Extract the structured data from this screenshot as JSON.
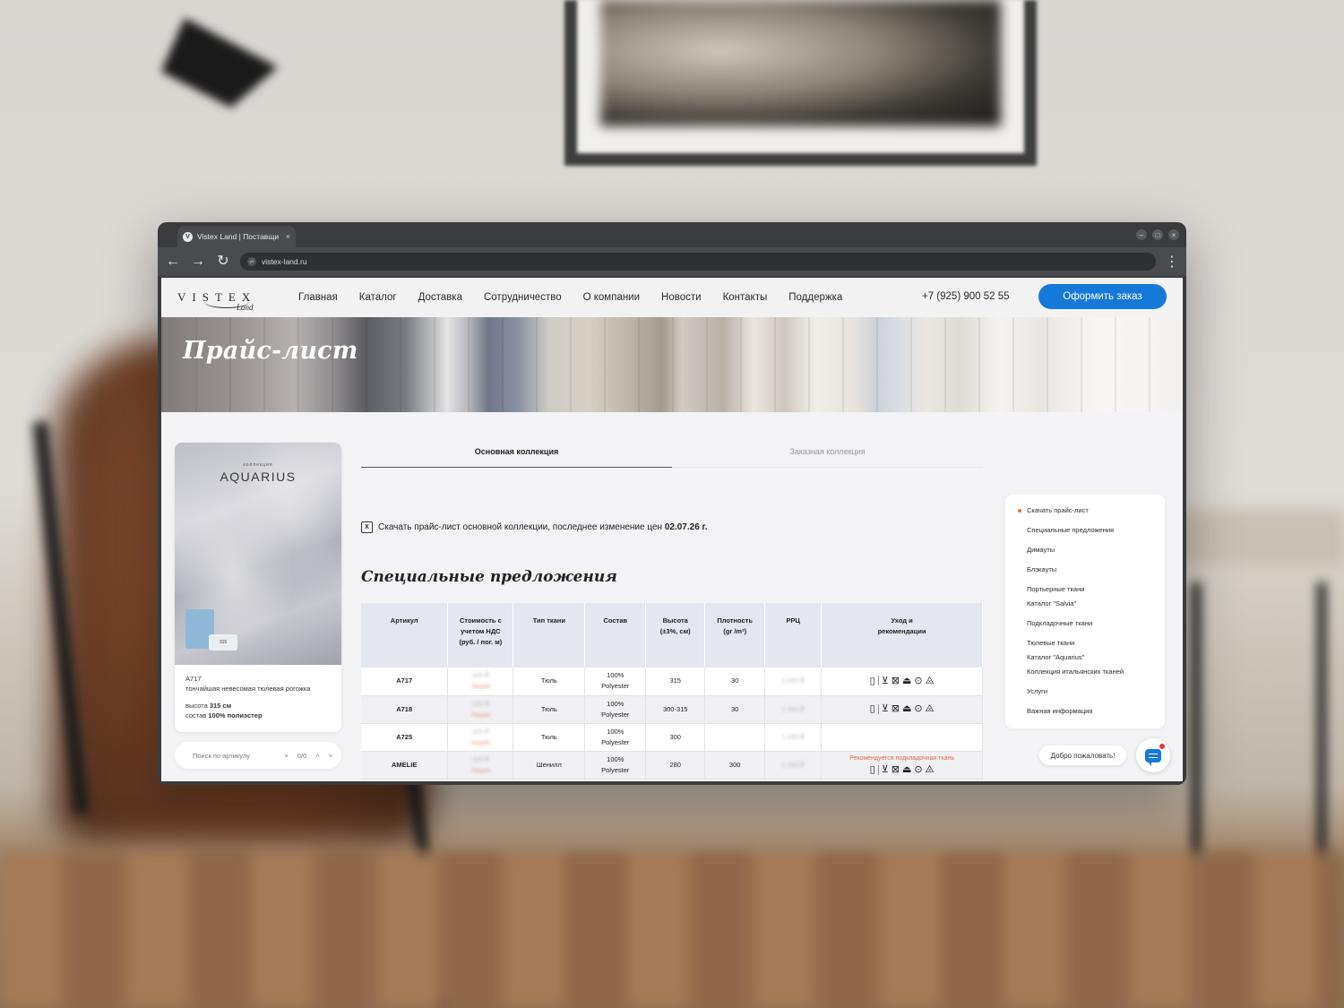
{
  "browser": {
    "tab_title": "Vistex Land | Поставщи",
    "tab_close": "×",
    "url": "vistex-land.ru",
    "menu": "⋮"
  },
  "site": {
    "logo_main": "VISTEX",
    "logo_sub": "Land",
    "nav": [
      "Главная",
      "Каталог",
      "Доставка",
      "Сотрудничество",
      "О компании",
      "Новости",
      "Контакты",
      "Поддержка"
    ],
    "phone": "+7 (925) 900 52 55",
    "order_button": "Оформить заказ"
  },
  "hero": {
    "title": "Прайс-лист"
  },
  "product_card": {
    "collection_small": "коллекция",
    "collection_name": "AQUARIUS",
    "box_label": "315",
    "article": "A717",
    "description": "тончайшая невесомая тюлевая рогожка",
    "height_label": "высота ",
    "height_value": "315 см",
    "composition_label": "состав ",
    "composition_value": "100% полиэстер"
  },
  "search": {
    "placeholder": "Поиск по артикулу",
    "clear": "×",
    "counter": "0/0",
    "up": "˄",
    "down": "˅"
  },
  "tabs": [
    "Основная коллекция",
    "Заказная коллекция"
  ],
  "download": {
    "text": "Скачать прайс-лист основной коллекции, последнее изменение цен ",
    "date": "02.07.26 г."
  },
  "section_title": "Специальные предложения",
  "table": {
    "headers": [
      "Артикул",
      "Стоимость с учетом НДС (руб. / пог. м)",
      "Тип ткани",
      "Состав",
      "Высота (±3%, см)",
      "Плотность (gr /m²)",
      "РРЦ",
      "Уход и рекомендации"
    ],
    "rows": [
      {
        "article": "A717",
        "price": "325 ₽",
        "price_note": "Акция",
        "type": "Тюль",
        "composition": "100% Polyester",
        "height": "315",
        "density": "30",
        "rrp": "1 050 ₽",
        "note": ""
      },
      {
        "article": "A718",
        "price": "325 ₽",
        "price_note": "Акция",
        "type": "Тюль",
        "composition": "100% Polyester",
        "height": "300-315",
        "density": "30",
        "rrp": "1 050 ₽",
        "note": ""
      },
      {
        "article": "A725",
        "price": "325 ₽",
        "price_note": "Акция",
        "type": "Тюль",
        "composition": "100% Polyester",
        "height": "300",
        "density": "",
        "rrp": "1 050 ₽",
        "note": ""
      },
      {
        "article": "AMELIE",
        "price": "325 ₽",
        "price_note": "Акция",
        "type": "Шенилл",
        "composition": "100% Polyester",
        "height": "280",
        "density": "300",
        "rrp": "1 050 ₽",
        "note": "Рекомендуется подкладочная ткань"
      }
    ]
  },
  "toc": [
    "Скачать прайс-лист",
    "Специальные предложения",
    "Димауты",
    "Блэкауты",
    "Портьерные ткани",
    "Каталог \"Salvia\"",
    "Подкладочные ткани",
    "Тюлевые ткани",
    "Каталог \"Aquarius\"",
    "Коллекция итальянских тканей",
    "Услуги",
    "Важная информация"
  ],
  "welcome": "Добро пожаловать!",
  "colors": {
    "accent": "#1479d8",
    "toc_active_dot": "#e07a3b",
    "note_red": "#e06a4e"
  }
}
